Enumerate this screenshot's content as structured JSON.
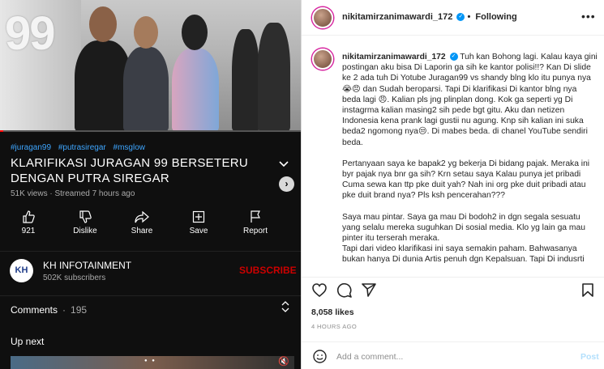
{
  "video": {
    "logo_text": "99",
    "progress": 0.01,
    "tags": [
      "#juragan99",
      "#putrasiregar",
      "#msglow"
    ],
    "title": "KLARIFIKASI JURAGAN 99 BERSETERU DENGAN PUTRA SIREGAR",
    "meta": "51K views · Streamed 7 hours ago",
    "actions": [
      {
        "icon": "thumbs-up-icon",
        "label": "921"
      },
      {
        "icon": "thumbs-down-icon",
        "label": "Dislike"
      },
      {
        "icon": "share-icon",
        "label": "Share"
      },
      {
        "icon": "save-icon",
        "label": "Save"
      },
      {
        "icon": "flag-icon",
        "label": "Report"
      }
    ],
    "channel": {
      "avatar_text": "KH",
      "name": "KH INFOTAINMENT",
      "subscribers": "502K subscribers",
      "subscribe_label": "SUBSCRIBE"
    },
    "comments_label": "Comments",
    "comments_count": "195",
    "up_next_label": "Up next"
  },
  "instagram": {
    "username": "nikitamirzanimawardi_172",
    "separator": "•",
    "follow_status": "Following",
    "caption_paragraphs": [
      "Tuh kan Bohong lagi. Kalau kaya gini postingan aku bisa Di Laporin ga sih ke kantor polisi!!? Kan Di slide ke 2 ada tuh Di Yotube Juragan99 vs shandy blng klo itu punya nya 😭😠 dan Sudah beroparsi. Tapi Di klarifikasi Di kantor blng nya beda lagi 😠. Kalian pls jng plinplan dong. Kok ga seperti yg Di instagrma kalian masing2 sih pede bgt gitu. Aku dan netizen Indonesia kena prank lagi gustii nu agung. Knp sih kalian ini suka beda2 ngomong nya😒. Di mabes beda. di chanel YouTube sendiri beda.",
      "Pertanyaan saya ke bapak2 yg bekerja Di bidang pajak. Meraka ini byr pajak nya bnr ga sih? Krn setau saya Kalau punya jet pribadi Cuma sewa kan ttp pke duit yah? Nah ini org pke duit pribadi atau pke duit brand nya? Pls ksh pencerahan???",
      "Saya mau pintar. Saya ga mau Di bodoh2 in dgn segala sesuatu yang selalu mereka suguhkan Di sosial media. Klo yg lain ga mau pinter itu terserah meraka.\nTapi dari video klarifikasi ini saya semakin paham. Bahwasanya bukan hanya Di dunia Artis penuh dgn Kepalsuan. Tapi Di indusrti"
    ],
    "likes": "8,058 likes",
    "time_ago": "4 HOURS AGO",
    "comment_placeholder": "Add a comment...",
    "post_label": "Post",
    "accent_color": "#0095f6"
  }
}
